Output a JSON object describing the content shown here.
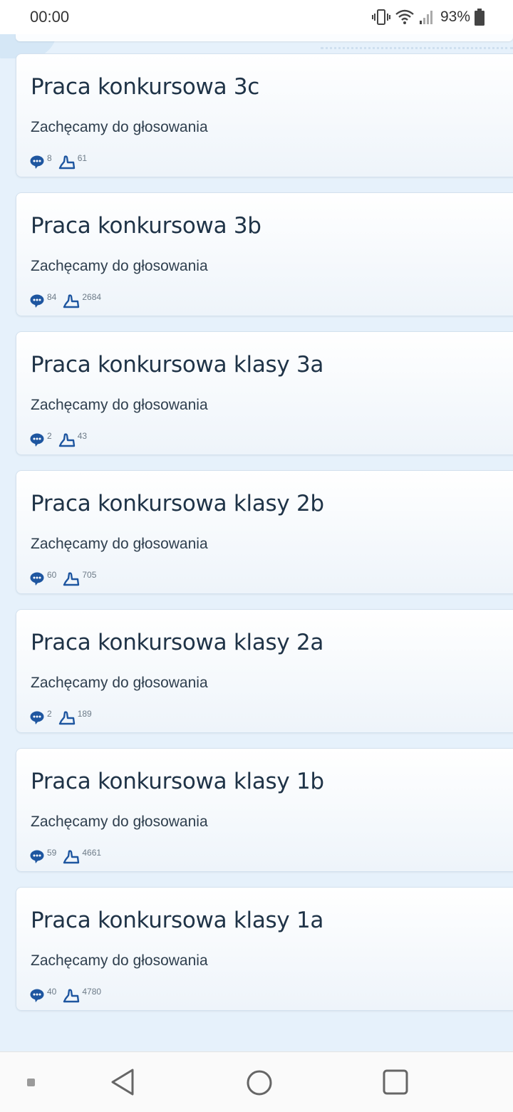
{
  "status_bar": {
    "time": "00:00",
    "battery": "93%",
    "icons": [
      "vibrate-icon",
      "wifi-icon",
      "signal-icon",
      "battery-icon"
    ]
  },
  "posts": [
    {
      "title": "Praca konkursowa 3c",
      "subtitle": "Zachęcamy do głosowania",
      "comments": "8",
      "likes": "61"
    },
    {
      "title": "Praca konkursowa 3b",
      "subtitle": "Zachęcamy do głosowania",
      "comments": "84",
      "likes": "2684"
    },
    {
      "title": "Praca konkursowa klasy 3a",
      "subtitle": "Zachęcamy do głosowania",
      "comments": "2",
      "likes": "43"
    },
    {
      "title": "Praca konkursowa klasy 2b",
      "subtitle": "Zachęcamy do głosowania",
      "comments": "60",
      "likes": "705"
    },
    {
      "title": "Praca konkursowa klasy 2a",
      "subtitle": "Zachęcamy do głosowania",
      "comments": "2",
      "likes": "189"
    },
    {
      "title": "Praca konkursowa klasy 1b",
      "subtitle": "Zachęcamy do głosowania",
      "comments": "59",
      "likes": "4661"
    },
    {
      "title": "Praca konkursowa klasy 1a",
      "subtitle": "Zachęcamy do głosowania",
      "comments": "40",
      "likes": "4780"
    }
  ],
  "nav_bar": {
    "icons": [
      "recents-dot-icon",
      "back-icon",
      "home-icon",
      "overview-icon"
    ]
  },
  "colors": {
    "background": "#e6f1fb",
    "title": "#1f3347",
    "icon_blue": "#1e56a0"
  }
}
